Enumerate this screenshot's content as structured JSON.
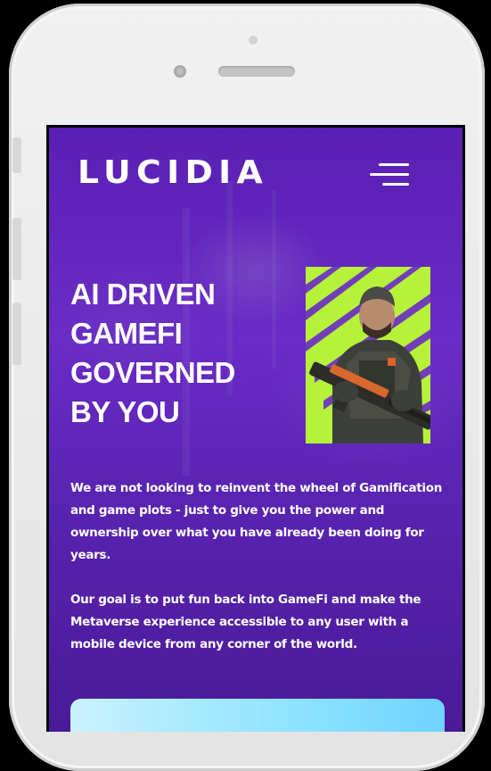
{
  "app": {
    "logo_text": "LUCIDIA"
  },
  "nav": {
    "menu_icon": "hamburger-menu-icon"
  },
  "hero": {
    "title_lines": [
      "AI DRIVEN",
      "GAMEFI",
      "GOVERNED",
      "BY YOU"
    ],
    "image": "soldier-character-with-rifle",
    "image_bg_color": "#b6f23a"
  },
  "content": {
    "paragraph_1": "We are not looking to reinvent the wheel of Gamification and game plots - just to give you the power and ownership over what you have already been doing for years.",
    "paragraph_2": "Our goal is to put fun back into GameFi and make the Metaverse experience accessible to any user with a mobile device from any corner of the world."
  },
  "colors": {
    "background_purple": "#5a1fb3",
    "accent_lime": "#b6f23a",
    "cta_cyan": "#8ee3ff",
    "text": "#ffffff"
  }
}
